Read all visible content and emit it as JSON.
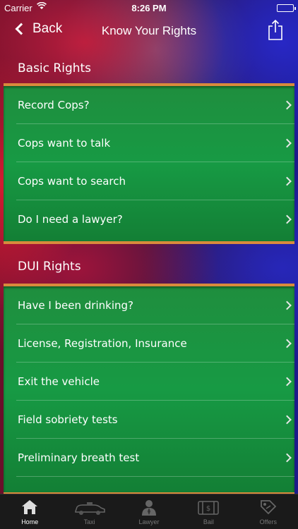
{
  "status_bar": {
    "carrier": "Carrier",
    "time": "8:26 PM"
  },
  "nav": {
    "back_label": "Back",
    "title": "Know Your Rights"
  },
  "sections": [
    {
      "header": "Basic Rights",
      "items": [
        "Record Cops?",
        "Cops want to talk",
        "Cops want to search",
        "Do I need a lawyer?"
      ]
    },
    {
      "header": "DUI Rights",
      "items": [
        "Have I been drinking?",
        "License, Registration, Insurance",
        "Exit the vehicle",
        "Field sobriety tests",
        "Preliminary breath test"
      ]
    }
  ],
  "tabs": [
    {
      "label": "Home",
      "icon": "home-icon",
      "active": true
    },
    {
      "label": "Taxi",
      "icon": "taxi-icon",
      "active": false
    },
    {
      "label": "Lawyer",
      "icon": "lawyer-icon",
      "active": false
    },
    {
      "label": "Bail",
      "icon": "bail-icon",
      "active": false
    },
    {
      "label": "Offers",
      "icon": "offers-icon",
      "active": false
    }
  ],
  "colors": {
    "accent_orange": "#d98a3c",
    "panel_green": "#179a44"
  }
}
